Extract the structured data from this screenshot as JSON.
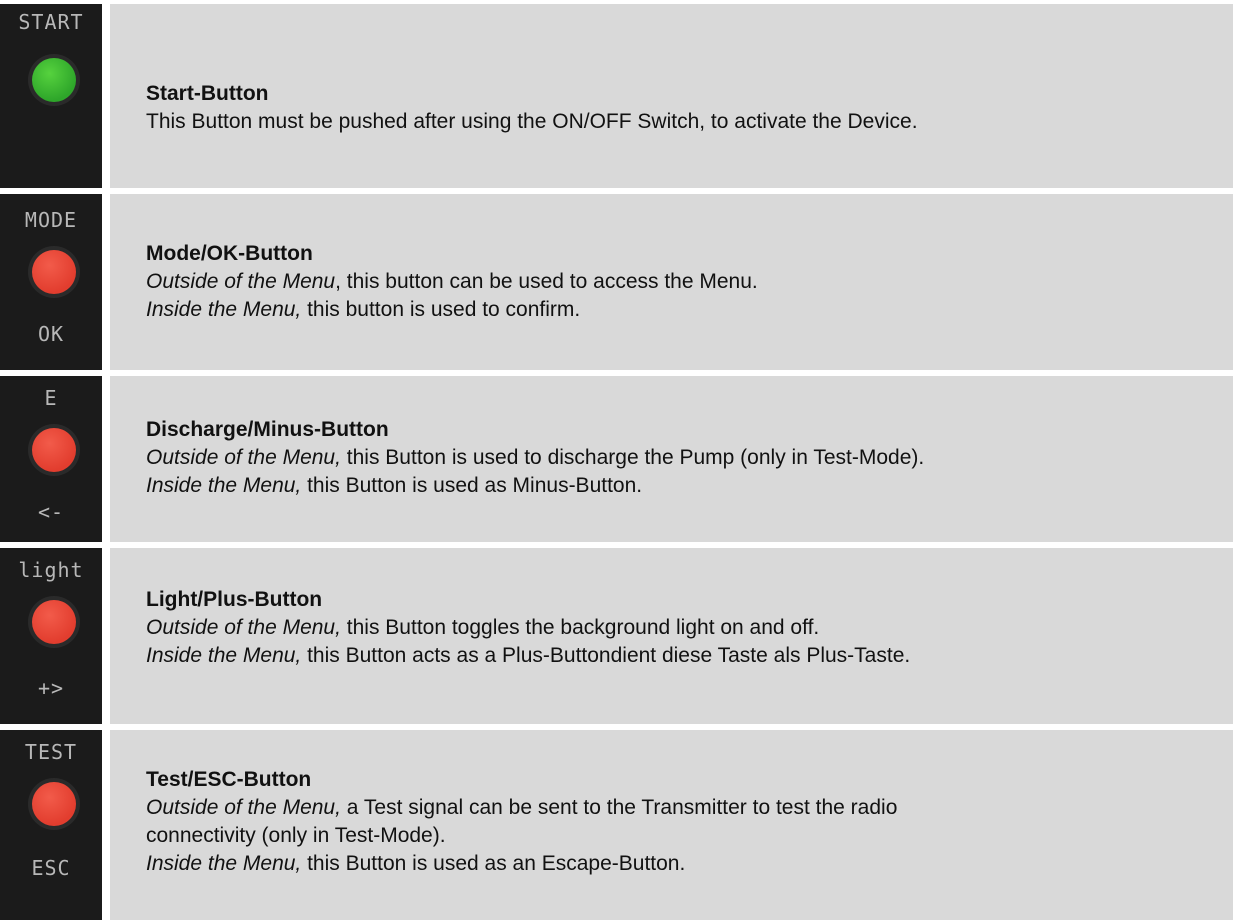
{
  "rows": [
    {
      "icon": {
        "top": "START",
        "bottom": "",
        "color": "#3cb531",
        "name": "green-button-icon"
      },
      "title": "Start-Button",
      "lines": [
        {
          "em": "",
          "text": "This Button must be pushed after using the ON/OFF Switch, to activate the Device."
        }
      ]
    },
    {
      "icon": {
        "top": "MODE",
        "bottom": "OK",
        "color": "#e8412f",
        "name": "red-button-icon"
      },
      "title": "Mode/OK-Button",
      "lines": [
        {
          "em": "Outside of the Menu",
          "text": ", this button can be used to access the Menu."
        },
        {
          "em": "Inside the Menu,",
          "text": " this button is used to confirm."
        }
      ]
    },
    {
      "icon": {
        "top": "E",
        "bottom": "<-",
        "color": "#e8412f",
        "name": "red-button-icon"
      },
      "title": "Discharge/Minus-Button",
      "lines": [
        {
          "em": "Outside of the Menu,",
          "text": " this Button is used to discharge the Pump (only in Test-Mode)."
        },
        {
          "em": "Inside the Menu,",
          "text": " this Button is used as Minus-Button."
        }
      ]
    },
    {
      "icon": {
        "top": "light",
        "bottom": "+>",
        "color": "#e8412f",
        "name": "red-button-icon"
      },
      "title": "Light/Plus-Button",
      "lines": [
        {
          "em": "Outside of the Menu,",
          "text": " this Button toggles the background light on and off."
        },
        {
          "em": "Inside the Menu,",
          "text": " this Button acts as a Plus-Buttondient diese Taste als Plus-Taste."
        }
      ]
    },
    {
      "icon": {
        "top": "TEST",
        "bottom": "ESC",
        "color": "#e8412f",
        "name": "red-button-icon"
      },
      "title": "Test/ESC-Button",
      "lines": [
        {
          "em": "Outside of the Menu,",
          "text": " a Test signal can be sent to the Transmitter to test the radio"
        },
        {
          "em": "",
          "text": "connectivity (only in Test-Mode)."
        },
        {
          "em": "Inside the Menu,",
          "text": " this Button is used as an Escape-Button."
        }
      ]
    }
  ]
}
